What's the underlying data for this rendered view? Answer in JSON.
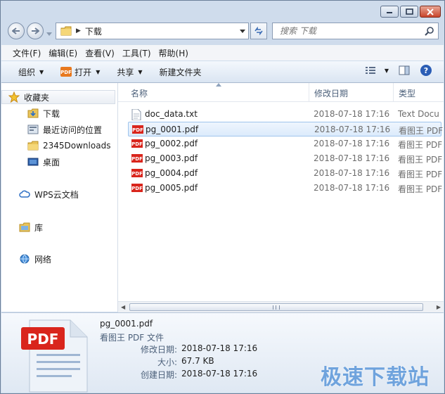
{
  "window": {
    "caption_buttons": [
      "minimize",
      "maximize",
      "close"
    ]
  },
  "address_bar": {
    "crumbs": [
      "下载"
    ]
  },
  "search": {
    "placeholder": "搜索 下载"
  },
  "menu": [
    "文件(F)",
    "编辑(E)",
    "查看(V)",
    "工具(T)",
    "帮助(H)"
  ],
  "toolbar": {
    "organize": "组织",
    "open": "打开",
    "share": "共享",
    "new_folder": "新建文件夹"
  },
  "nav_pane": {
    "favorites": "收藏夹",
    "fav_items": [
      "下载",
      "最近访问的位置",
      "2345Downloads",
      "桌面"
    ],
    "wps": "WPS云文档",
    "library": "库",
    "network": "网络"
  },
  "columns": {
    "name": "名称",
    "date": "修改日期",
    "type": "类型"
  },
  "files": [
    {
      "name": "doc_data.txt",
      "date": "2018-07-18 17:16",
      "type": "Text Docu",
      "icon": "text-file-icon"
    },
    {
      "name": "pg_0001.pdf",
      "date": "2018-07-18 17:16",
      "type": "看图王 PDF",
      "icon": "pdf-icon",
      "selected": true
    },
    {
      "name": "pg_0002.pdf",
      "date": "2018-07-18 17:16",
      "type": "看图王 PDF",
      "icon": "pdf-icon"
    },
    {
      "name": "pg_0003.pdf",
      "date": "2018-07-18 17:16",
      "type": "看图王 PDF",
      "icon": "pdf-icon"
    },
    {
      "name": "pg_0004.pdf",
      "date": "2018-07-18 17:16",
      "type": "看图王 PDF",
      "icon": "pdf-icon"
    },
    {
      "name": "pg_0005.pdf",
      "date": "2018-07-18 17:16",
      "type": "看图王 PDF",
      "icon": "pdf-icon"
    }
  ],
  "details": {
    "icon_text": "PDF",
    "name": "pg_0001.pdf",
    "type": "看图王 PDF 文件",
    "modified_label": "修改日期:",
    "modified": "2018-07-18 17:16",
    "size_label": "大小:",
    "size": "67.7 KB",
    "created_label": "创建日期:",
    "created": "2018-07-18 17:16"
  },
  "watermark": "极速下载站",
  "colors": {
    "pdf_red": "#d9251c",
    "selection": "#dcebfc",
    "watermark": "#6fa3dd"
  }
}
